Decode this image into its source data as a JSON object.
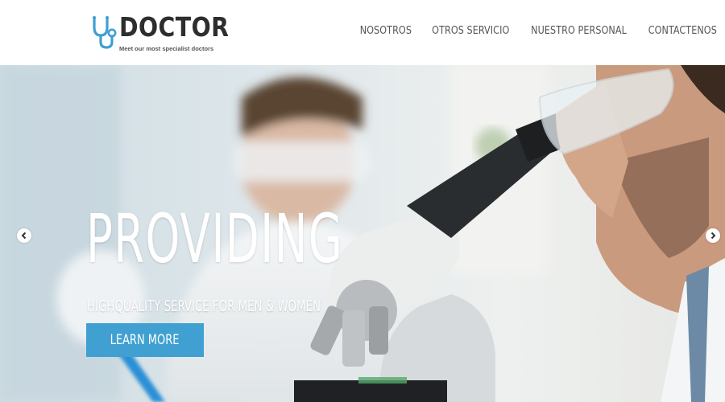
{
  "header": {
    "logo": {
      "name": "DOCTOR",
      "tagline": "Meet our most specialist doctors",
      "icon": "stethoscope-icon",
      "accent": "#3fa0d1"
    },
    "nav": [
      {
        "label": "NOSOTROS"
      },
      {
        "label": "OTROS SERVICIO"
      },
      {
        "label": "NUESTRO PERSONAL"
      },
      {
        "label": "CONTACTENOS"
      }
    ]
  },
  "hero": {
    "title": "PROVIDING",
    "subtitle": "HIGHQUALITY SERVICE FOR MEN & WOMEN",
    "button_label": "LEARN MORE",
    "button_color": "#3fa0d1",
    "prev_icon": "chevron-left-icon",
    "next_icon": "chevron-right-icon"
  }
}
